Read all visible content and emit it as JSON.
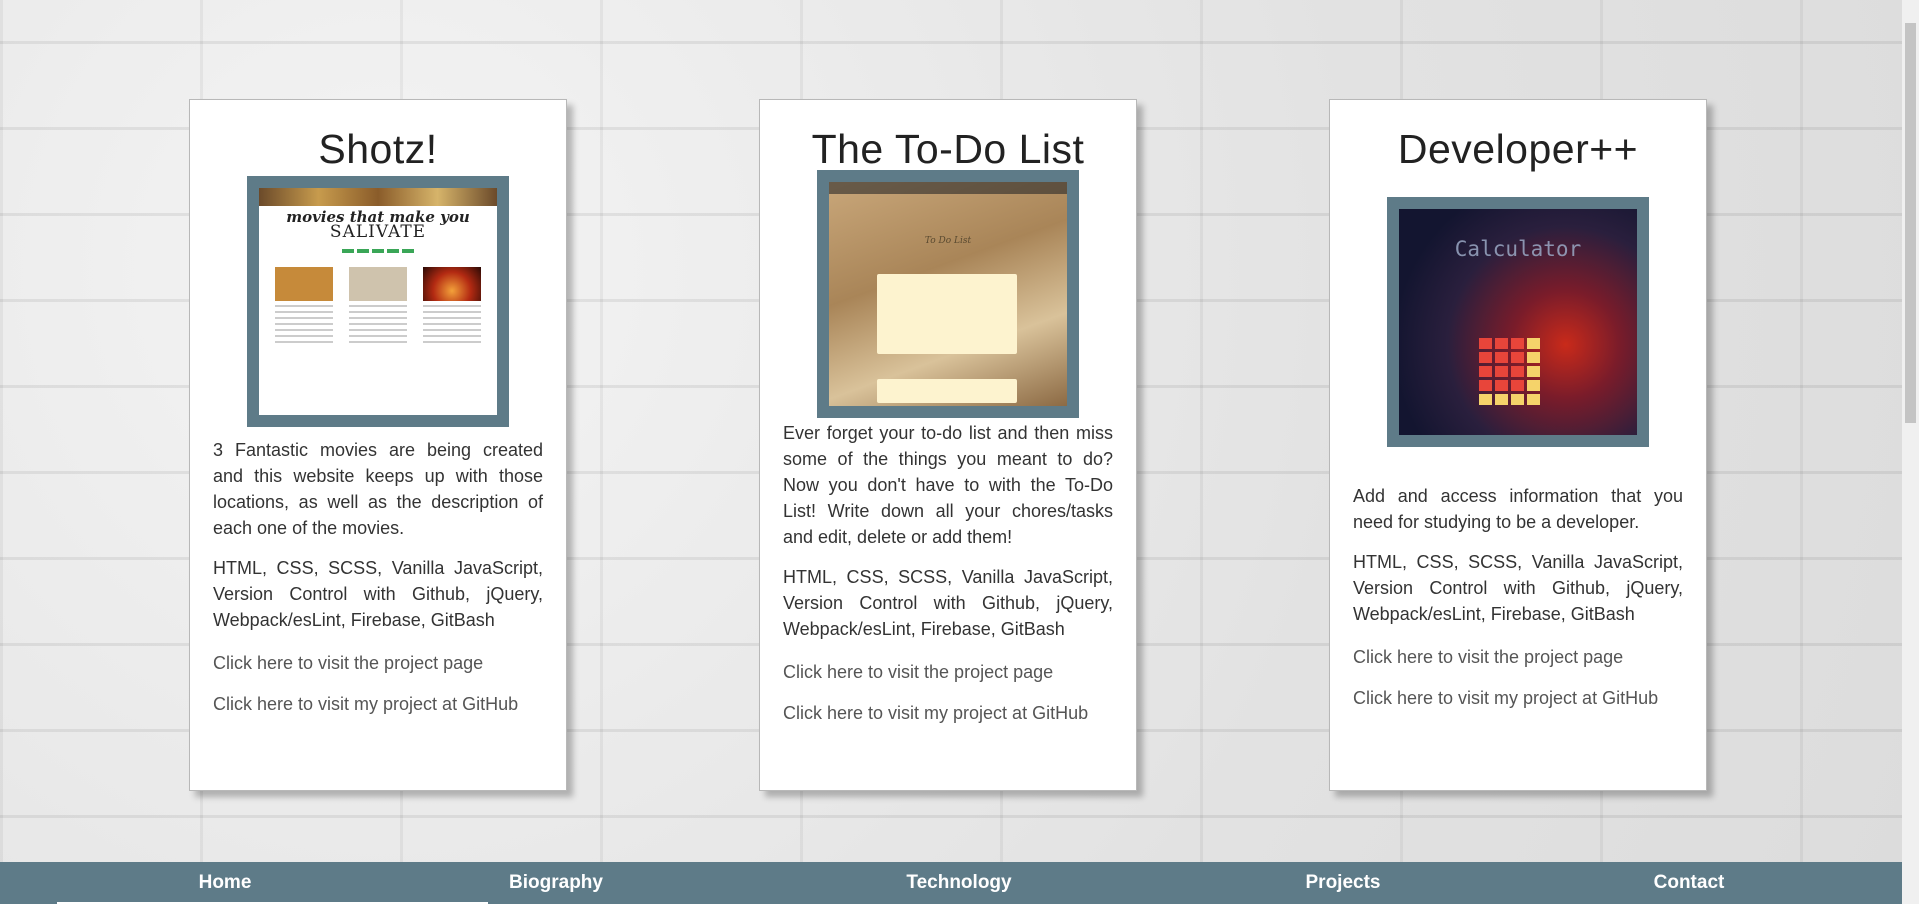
{
  "projects": [
    {
      "title": "Shotz!",
      "thumb": {
        "logo_line1": "movies that make you",
        "logo_line2": "SALIVATE"
      },
      "description": "3 Fantastic movies are being created and this website keeps up with those locations, as well as the description of each one of the movies.",
      "tech": "HTML, CSS, SCSS, Vanilla JavaScript, Version Control with Github, jQuery, Webpack/esLint, Firebase, GitBash",
      "project_link": "Click here to visit the project page",
      "github_link": "Click here to visit my project at GitHub"
    },
    {
      "title": "The To-Do List",
      "thumb": {
        "heading": "To Do List"
      },
      "description": "Ever forget your to-do list and then miss some of the things you meant to do? Now you don't have to with the To-Do List! Write down all your chores/tasks and edit, delete or add them!",
      "tech": "HTML, CSS, SCSS, Vanilla JavaScript, Version Control with Github, jQuery, Webpack/esLint, Firebase, GitBash",
      "project_link": "Click here to visit the project page",
      "github_link": "Click here to visit my project at GitHub"
    },
    {
      "title": "Developer++",
      "thumb": {
        "heading": "Calculator"
      },
      "description": "Add and access information that you need for studying to be a developer.",
      "tech": "HTML, CSS, SCSS, Vanilla JavaScript, Version Control with Github, jQuery, Webpack/esLint, Firebase, GitBash",
      "project_link": "Click here to visit the project page",
      "github_link": "Click here to visit my project at GitHub"
    }
  ],
  "nav": {
    "items": [
      "Home",
      "Biography",
      "Technology",
      "Projects",
      "Contact"
    ],
    "active": "Home",
    "background": "#5e7b88"
  }
}
